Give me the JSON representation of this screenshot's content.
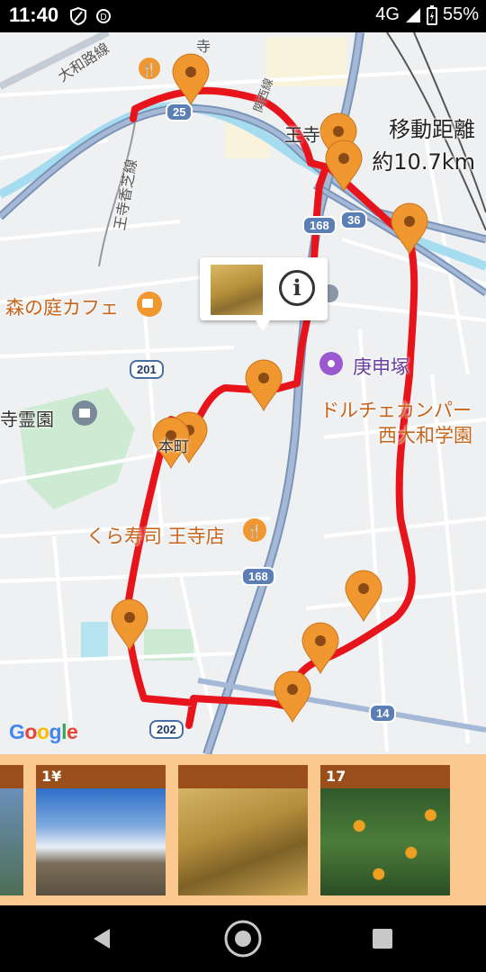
{
  "status_bar": {
    "time": "11:40",
    "network": "4G",
    "battery": "55%",
    "icons": [
      "shield-icon",
      "data-saver-icon",
      "signal-icon",
      "battery-icon"
    ]
  },
  "map": {
    "labels": {
      "yamato_road": "大和路線",
      "temple_top": "寺",
      "station_line": "関西線",
      "oji_sakurai_line": "王寺香芝線",
      "oji": "王寺",
      "mori_cafe": "森の庭カフェ",
      "koshinzuka": "庚申塚",
      "dolce": "ドルチェカンパー",
      "nishi_yamato": "西大和学園",
      "cemetery": "寺霊園",
      "honmachi": "本町",
      "kura_sushi": "くら寿司 王寺店"
    },
    "roads": [
      "25",
      "168",
      "36",
      "201",
      "168",
      "202",
      "14"
    ],
    "distance": {
      "title": "移動距離",
      "value": "約10.7km"
    },
    "route_color": "#e8141b",
    "marker_color": "#f0972f",
    "google": [
      "G",
      "o",
      "o",
      "g",
      "l",
      "e"
    ]
  },
  "photo_strip": {
    "cards": [
      {
        "label": ""
      },
      {
        "label": "1¥"
      },
      {
        "label": ""
      },
      {
        "label": "17"
      }
    ]
  },
  "nav": {
    "back": "back-icon",
    "home": "home-icon",
    "recents": "recents-icon"
  }
}
